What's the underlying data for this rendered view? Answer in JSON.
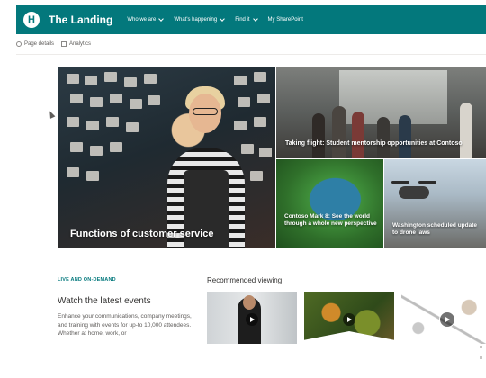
{
  "hub": {
    "logo_letter": "H",
    "title": "The Landing",
    "nav": [
      {
        "label": "Who we are",
        "has_menu": true
      },
      {
        "label": "What's happening",
        "has_menu": true
      },
      {
        "label": "Find it",
        "has_menu": true
      },
      {
        "label": "My SharePoint",
        "has_menu": false
      }
    ],
    "brand_color": "#03787c"
  },
  "commands": [
    {
      "label": "Page details",
      "icon": "info-icon"
    },
    {
      "label": "Analytics",
      "icon": "analytics-icon"
    }
  ],
  "hero": {
    "main": {
      "caption": "Functions of customer service"
    },
    "top_right": {
      "caption": "Taking flight: Student mentorship opportunities at Contoso"
    },
    "bottom_left": {
      "caption": "Contoso Mark 8: See the world through a whole new perspective"
    },
    "bottom_right": {
      "caption": "Washington scheduled update to drone laws"
    }
  },
  "events": {
    "eyebrow": "LIVE AND ON-DEMAND",
    "title": "Watch the latest events",
    "description": "Enhance your communications, company meetings, and training with events for up-to 10,000 attendees. Whether at home, work, or"
  },
  "recommended": {
    "title": "Recommended viewing",
    "videos": [
      {
        "name": "video-1"
      },
      {
        "name": "video-2"
      },
      {
        "name": "video-3"
      }
    ]
  }
}
